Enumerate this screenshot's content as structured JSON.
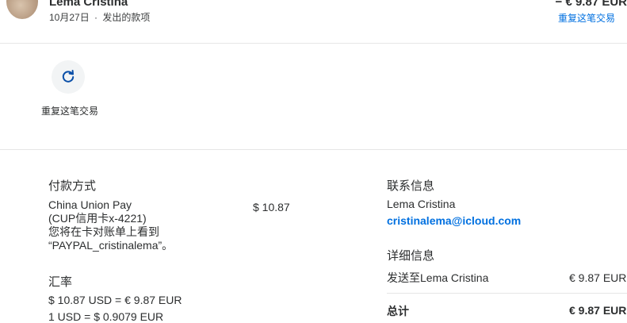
{
  "header": {
    "name": "Lema Cristina",
    "date": "10月27日",
    "separator": "·",
    "type": "发出的款项",
    "amount": "− € 9.87 EUR",
    "repeat_link": "重复这笔交易"
  },
  "actions": {
    "repeat_label": "重复这笔交易",
    "icon": "refresh-icon"
  },
  "payment": {
    "heading": "付款方式",
    "method_line1": "China Union Pay",
    "method_line2": "(CUP信用卡x-4221)",
    "method_line3": "您将在卡对账单上看到",
    "method_line4": "“PAYPAL_cristinalema”。",
    "amount": "$ 10.87"
  },
  "exchange": {
    "heading": "汇率",
    "line1": "$ 10.87 USD = € 9.87 EUR",
    "line2": "1 USD = $ 0.9079 EUR"
  },
  "contact": {
    "heading": "联系信息",
    "name": "Lema Cristina",
    "email": "cristinalema@icloud.com"
  },
  "details": {
    "heading": "详细信息",
    "sent_to_label": "发送至Lema Cristina",
    "sent_to_amount": "€ 9.87 EUR",
    "total_label": "总计",
    "total_amount": "€ 9.87 EUR"
  },
  "colors": {
    "link": "#0070e0",
    "text": "#2c2e2f",
    "divider": "#e6e6e6",
    "icon_bg": "#f2f4f5"
  }
}
